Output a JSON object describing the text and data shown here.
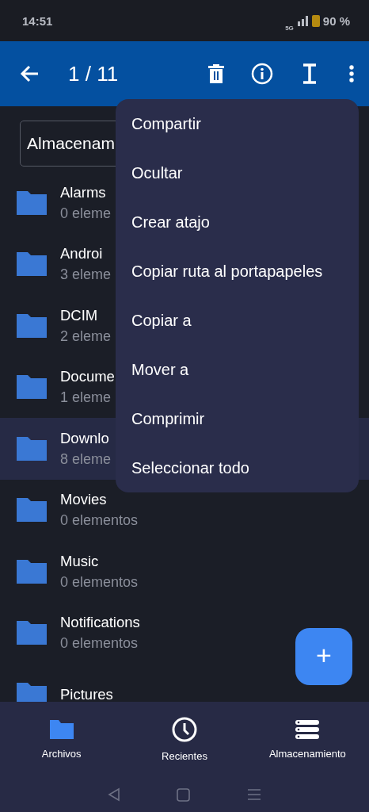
{
  "status_bar": {
    "time": "14:51",
    "network": "5G",
    "battery": "90 %"
  },
  "toolbar": {
    "counter": "1 / 11"
  },
  "storage_dropdown": {
    "value": "Almacenam"
  },
  "folders": [
    {
      "name": "Alarms",
      "count": "0 eleme",
      "selected": false
    },
    {
      "name": "Androi",
      "count": "3 eleme",
      "selected": false
    },
    {
      "name": "DCIM",
      "count": "2 eleme",
      "selected": false
    },
    {
      "name": "Docume",
      "count": "1 eleme",
      "selected": false
    },
    {
      "name": "Downlo",
      "count": "8 eleme",
      "selected": true
    },
    {
      "name": "Movies",
      "count": "0 elementos",
      "selected": false
    },
    {
      "name": "Music",
      "count": "0 elementos",
      "selected": false
    },
    {
      "name": "Notifications",
      "count": "0 elementos",
      "selected": false
    },
    {
      "name": "Pictures",
      "selected": false
    }
  ],
  "menu": {
    "items": [
      "Compartir",
      "Ocultar",
      "Crear atajo",
      "Copiar ruta al portapapeles",
      "Copiar a",
      "Mover a",
      "Comprimir",
      "Seleccionar todo"
    ]
  },
  "fab": {
    "label": "+"
  },
  "bottom_nav": [
    {
      "kind": "folder",
      "label": "Archivos",
      "selected": true
    },
    {
      "kind": "clock",
      "label": "Recientes",
      "selected": false
    },
    {
      "kind": "storage",
      "label": "Almacenamiento",
      "selected": false
    }
  ]
}
